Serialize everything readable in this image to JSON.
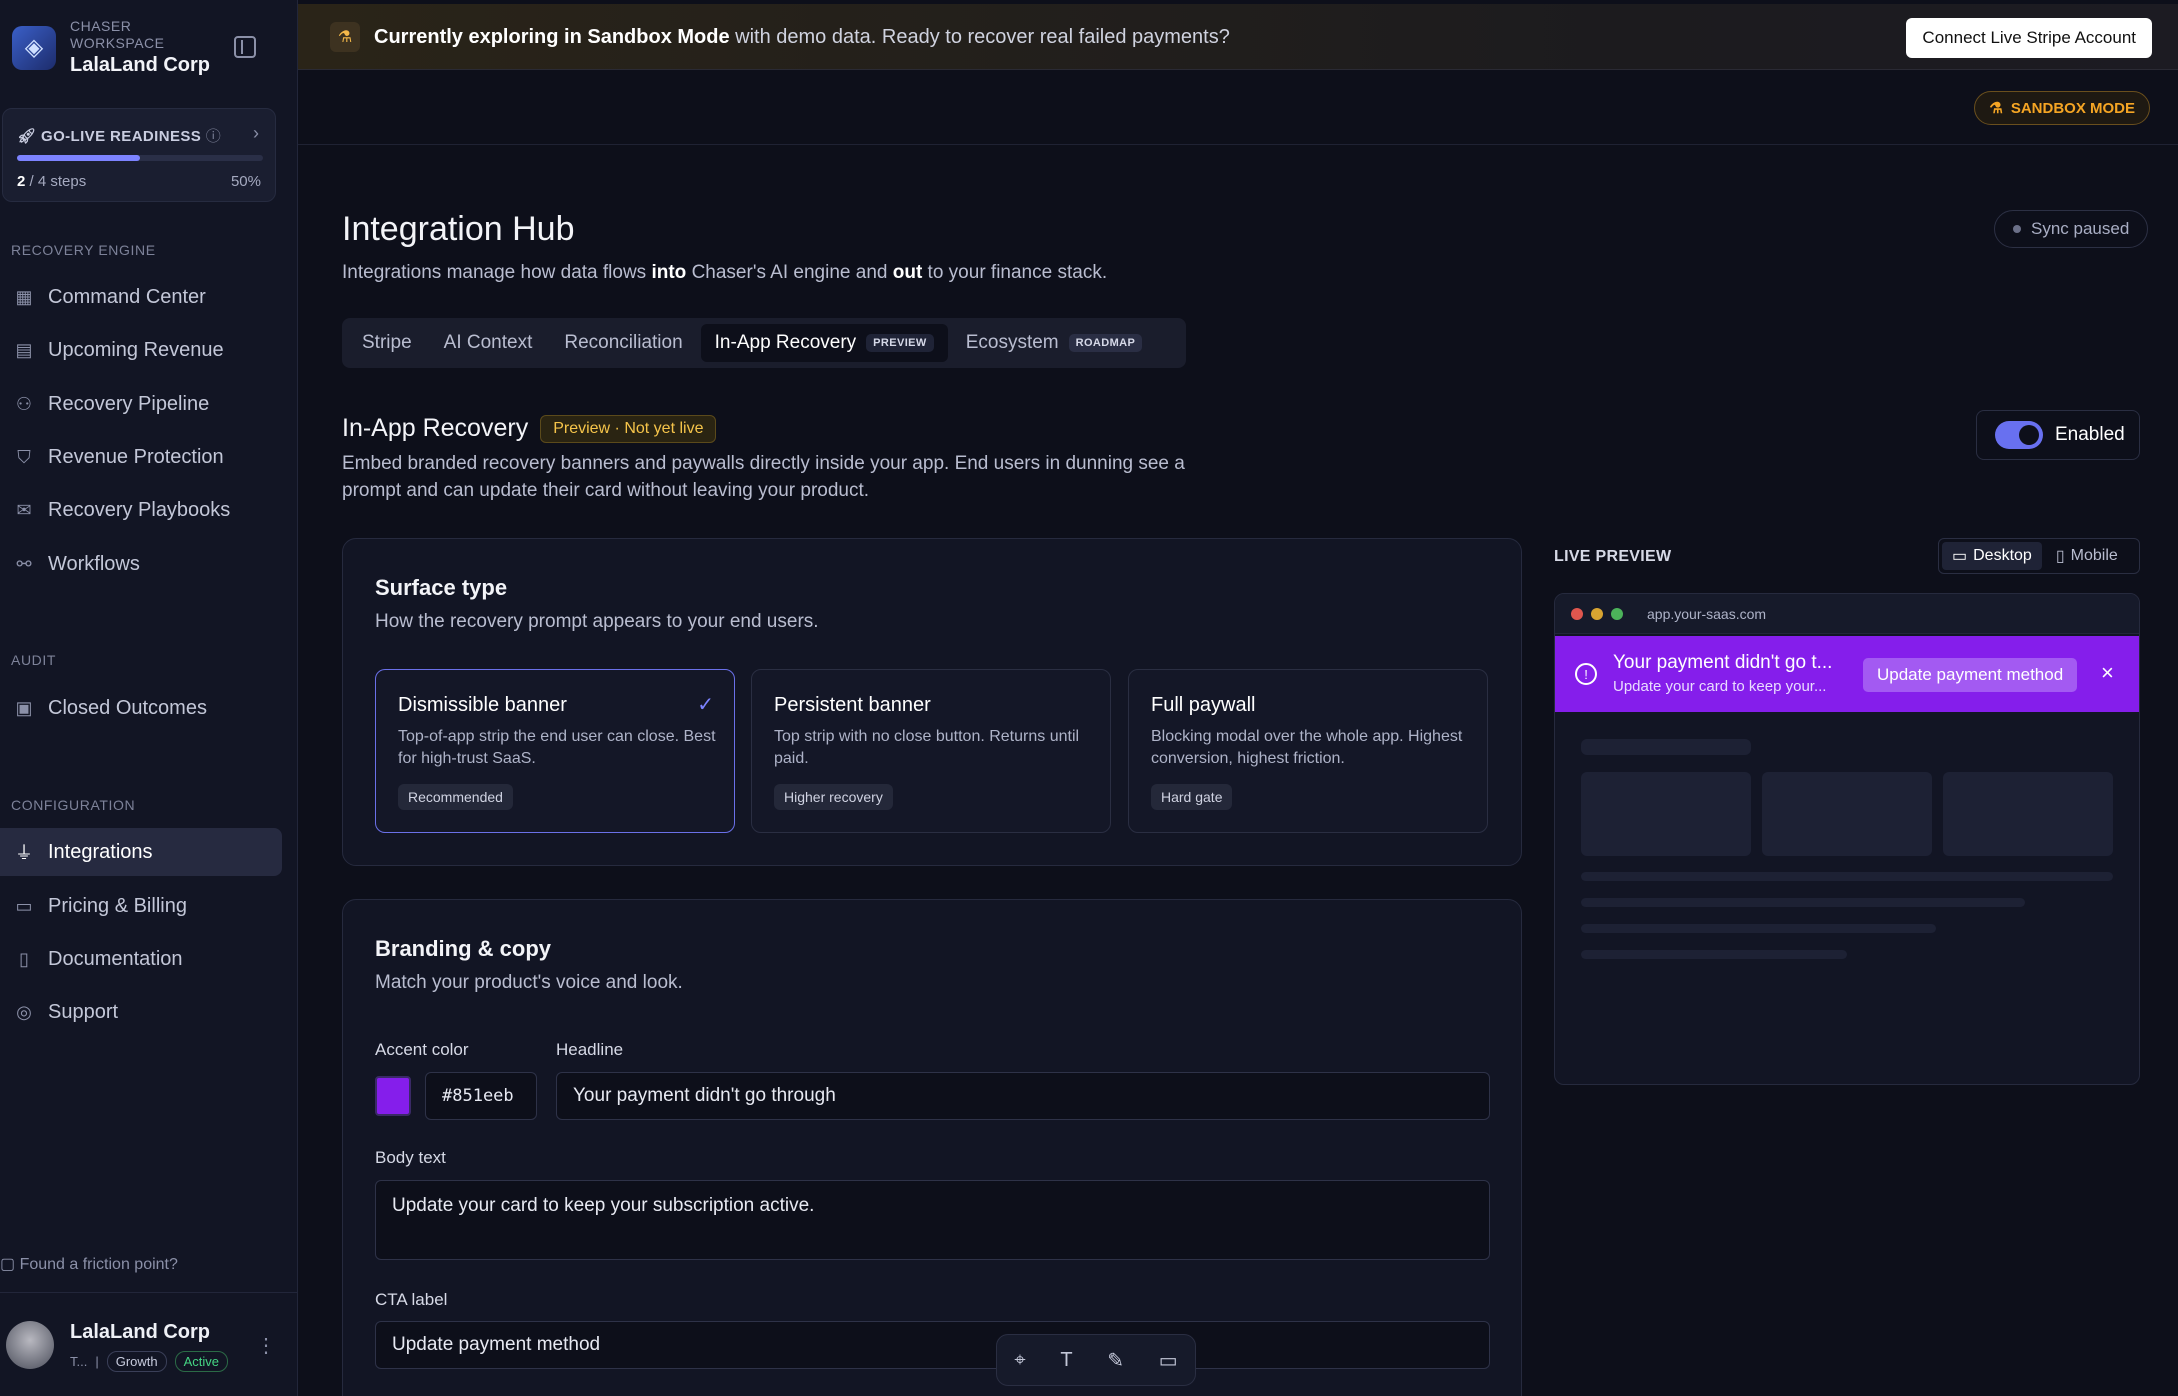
{
  "workspace": {
    "label": "CHASER WORKSPACE",
    "name": "LalaLand Corp"
  },
  "golive": {
    "title": "GO-LIVE READINESS",
    "steps_done": "2",
    "steps_total": "/ 4 steps",
    "percent": "50%",
    "progress": 0.5
  },
  "sidebar": {
    "sections": [
      {
        "title": "RECOVERY ENGINE"
      },
      {
        "title": "AUDIT"
      },
      {
        "title": "CONFIGURATION"
      }
    ],
    "items": [
      {
        "label": "Command Center",
        "icon": "grid-icon"
      },
      {
        "label": "Upcoming Revenue",
        "icon": "calendar-icon"
      },
      {
        "label": "Recovery Pipeline",
        "icon": "users-icon"
      },
      {
        "label": "Revenue Protection",
        "icon": "shield-icon"
      },
      {
        "label": "Recovery Playbooks",
        "icon": "mail-icon"
      },
      {
        "label": "Workflows",
        "icon": "workflow-icon"
      },
      {
        "label": "Closed Outcomes",
        "icon": "archive-icon"
      },
      {
        "label": "Integrations",
        "icon": "plug-icon"
      },
      {
        "label": "Pricing & Billing",
        "icon": "card-icon"
      },
      {
        "label": "Documentation",
        "icon": "book-icon"
      },
      {
        "label": "Support",
        "icon": "lifebuoy-icon"
      }
    ],
    "friction": "Found a friction point?",
    "user": {
      "name": "LalaLand Corp",
      "initial": "T...",
      "plan": "Growth",
      "status": "Active"
    }
  },
  "banner": {
    "bold": "Currently exploring in Sandbox Mode",
    "rest": " with demo data. Ready to recover real failed payments?",
    "button": "Connect Live Stripe Account"
  },
  "mode_badge": "SANDBOX MODE",
  "page": {
    "title": "Integration Hub",
    "subtitle_a": "Integrations manage how data flows ",
    "into": "into",
    "subtitle_b": " Chaser's AI engine and ",
    "out": "out",
    "subtitle_c": " to your finance stack.",
    "sync": "Sync paused"
  },
  "tabs": [
    {
      "label": "Stripe"
    },
    {
      "label": "AI Context"
    },
    {
      "label": "Reconciliation"
    },
    {
      "label": "In-App Recovery",
      "pill": "PREVIEW"
    },
    {
      "label": "Ecosystem",
      "pill": "ROADMAP"
    }
  ],
  "section": {
    "title": "In-App Recovery",
    "badge": "Preview · Not yet live",
    "desc": "Embed branded recovery banners and paywalls directly inside your app. End users in dunning see a prompt and can update their card without leaving your product.",
    "toggle": "Enabled"
  },
  "surface": {
    "title": "Surface type",
    "subtitle": "How the recovery prompt appears to your end users.",
    "options": [
      {
        "title": "Dismissible banner",
        "desc": "Top-of-app strip the end user can close. Best for high-trust SaaS.",
        "badge": "Recommended"
      },
      {
        "title": "Persistent banner",
        "desc": "Top strip with no close button. Returns until paid.",
        "badge": "Higher recovery"
      },
      {
        "title": "Full paywall",
        "desc": "Blocking modal over the whole app. Highest conversion, highest friction.",
        "badge": "Hard gate"
      }
    ]
  },
  "branding": {
    "title": "Branding & copy",
    "subtitle": "Match your product's voice and look.",
    "accent_label": "Accent color",
    "accent_value": "#851eeb",
    "headline_label": "Headline",
    "headline": "Your payment didn't go through",
    "body_label": "Body text",
    "body": "Update your card to keep your subscription active.",
    "cta_label": "CTA label",
    "cta": "Update payment method"
  },
  "preview": {
    "label": "LIVE PREVIEW",
    "desktop": "Desktop",
    "mobile": "Mobile",
    "url": "app.your-saas.com",
    "headline": "Your payment didn't go t...",
    "body": "Update your card to keep your...",
    "cta": "Update payment method"
  },
  "colors": {
    "accent": "#851eeb",
    "primary": "#7c83ff",
    "warning": "#f5a524"
  }
}
